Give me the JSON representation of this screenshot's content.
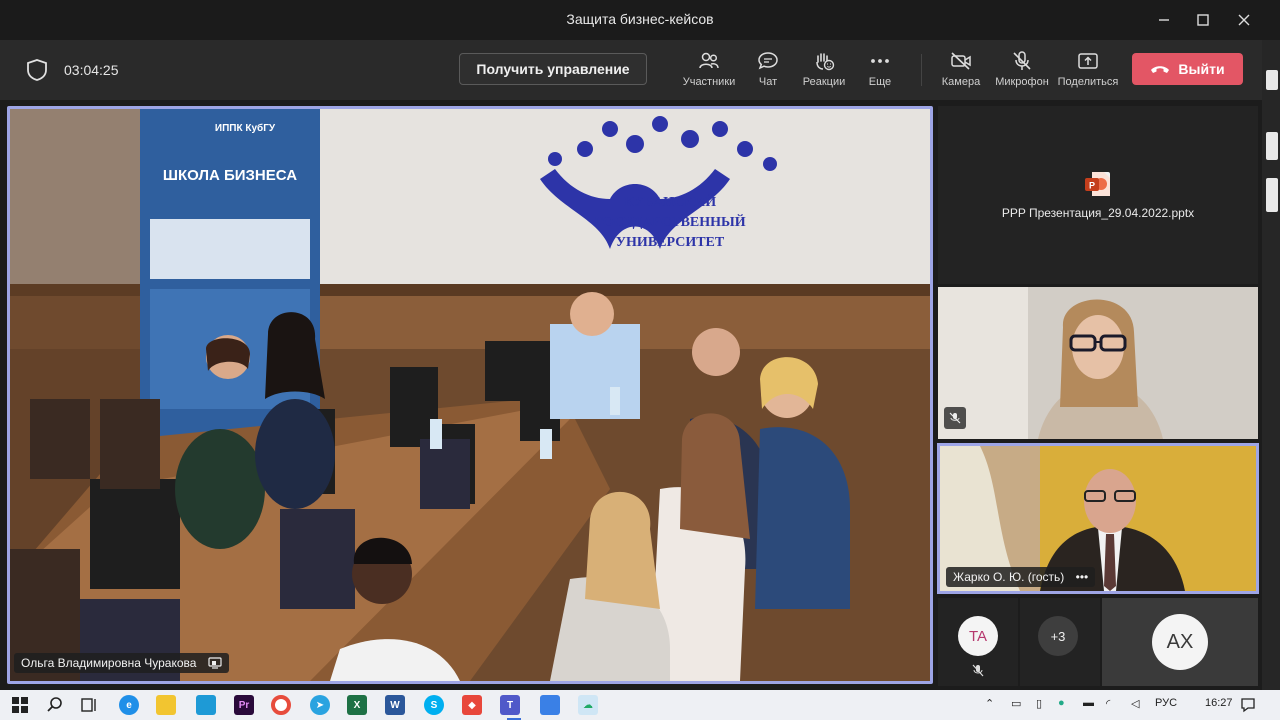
{
  "window": {
    "title": "Защита бизнес-кейсов",
    "minimize": "—",
    "maximize": "☐",
    "close": "✕"
  },
  "toolbar": {
    "timer": "03:04:25",
    "take_control_label": "Получить управление",
    "participants_label": "Участники",
    "chat_label": "Чат",
    "reactions_label": "Реакции",
    "more_label": "Еще",
    "camera_label": "Камера",
    "mic_label": "Микрофон",
    "share_label": "Поделиться",
    "leave_label": "Выйти"
  },
  "main_video": {
    "speaker_name": "Ольга Владимировна Чуракова",
    "banner_top": "ИППК КубГУ",
    "banner_title": "ШКОЛА БИЗНЕСА",
    "wall_sign_line1": "КУБАНСКИЙ",
    "wall_sign_line2": "ГОСУДАРСТВЕННЫЙ",
    "wall_sign_line3": "УНИВЕРСИТЕТ"
  },
  "shared_file": {
    "name": "PPP Презентация_29.04.2022.pptx",
    "icon": "powerpoint-icon"
  },
  "participants": {
    "woman_tile_muted": true,
    "man_tile_name": "Жарко О. Ю. (гость)",
    "man_tile_more": "•••",
    "ta_initials": "TA",
    "more_count": "+3",
    "ah_initials": "AX"
  },
  "colors": {
    "accent": "#9ea5e6",
    "leave": "#e35665",
    "ta_avatar_text": "#b6386e"
  },
  "taskbar": {
    "lang": "РУС",
    "time": "16:27"
  }
}
